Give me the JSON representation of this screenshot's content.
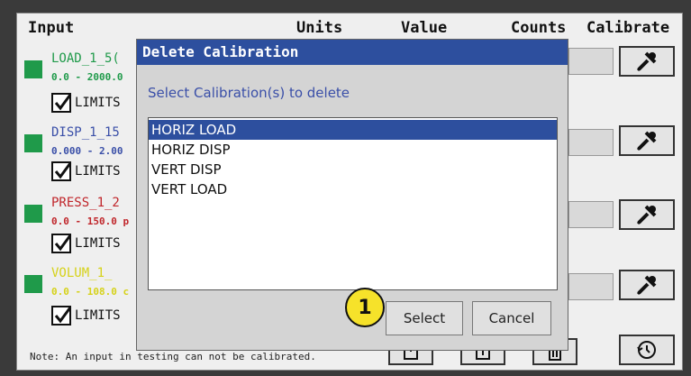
{
  "headers": {
    "input": "Input",
    "units": "Units",
    "value": "Value",
    "counts": "Counts",
    "calibrate": "Calibrate"
  },
  "inputs": [
    {
      "name": "LOAD_1_5(",
      "range": "0.0 - 2000.0",
      "limits": "LIMITS",
      "color": "#1f9a4a",
      "range_color": "#1f9a4a"
    },
    {
      "name": "DISP_1_15",
      "range": "0.000 - 2.00",
      "limits": "LIMITS",
      "color": "#3a4fa8",
      "range_color": "#3a4fa8"
    },
    {
      "name": "PRESS_1_2",
      "range": "0.0 - 150.0 p",
      "limits": "LIMITS",
      "color": "#c0262b",
      "range_color": "#c0262b"
    },
    {
      "name": "VOLUM_1_",
      "range": "0.0 - 108.0 c",
      "limits": "LIMITS",
      "color": "#d6d21a",
      "range_color": "#d6d21a"
    }
  ],
  "note": "Note: An input in testing can not be calibrated.",
  "icons": {
    "calibrate": "wrench-screwdriver-icon",
    "import": "import-icon",
    "export": "export-icon",
    "delete": "trash-icon",
    "history": "history-icon"
  },
  "dialog": {
    "title": "Delete Calibration",
    "prompt": "Select Calibration(s) to delete",
    "items": [
      "HORIZ LOAD",
      "HORIZ DISP",
      "VERT DISP",
      "VERT LOAD"
    ],
    "selected_index": 0,
    "select_label": "Select",
    "cancel_label": "Cancel"
  },
  "callout": "1"
}
